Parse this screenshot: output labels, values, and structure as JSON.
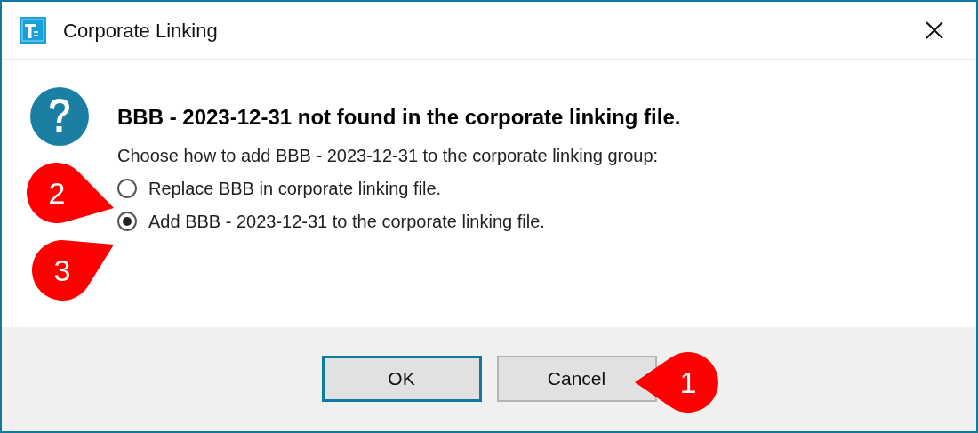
{
  "window": {
    "title": "Corporate Linking"
  },
  "message": {
    "heading": "BBB - 2023-12-31 not found in the corporate linking file.",
    "prompt": "Choose how to add BBB - 2023-12-31 to the corporate linking group:"
  },
  "options": [
    {
      "label": "Replace BBB in corporate linking file.",
      "selected": false
    },
    {
      "label": "Add BBB - 2023-12-31 to the corporate linking file.",
      "selected": true
    }
  ],
  "buttons": [
    {
      "label": "OK",
      "default": true
    },
    {
      "label": "Cancel",
      "default": false
    }
  ],
  "callouts": [
    {
      "number": "1"
    },
    {
      "number": "2"
    },
    {
      "number": "3"
    }
  ]
}
